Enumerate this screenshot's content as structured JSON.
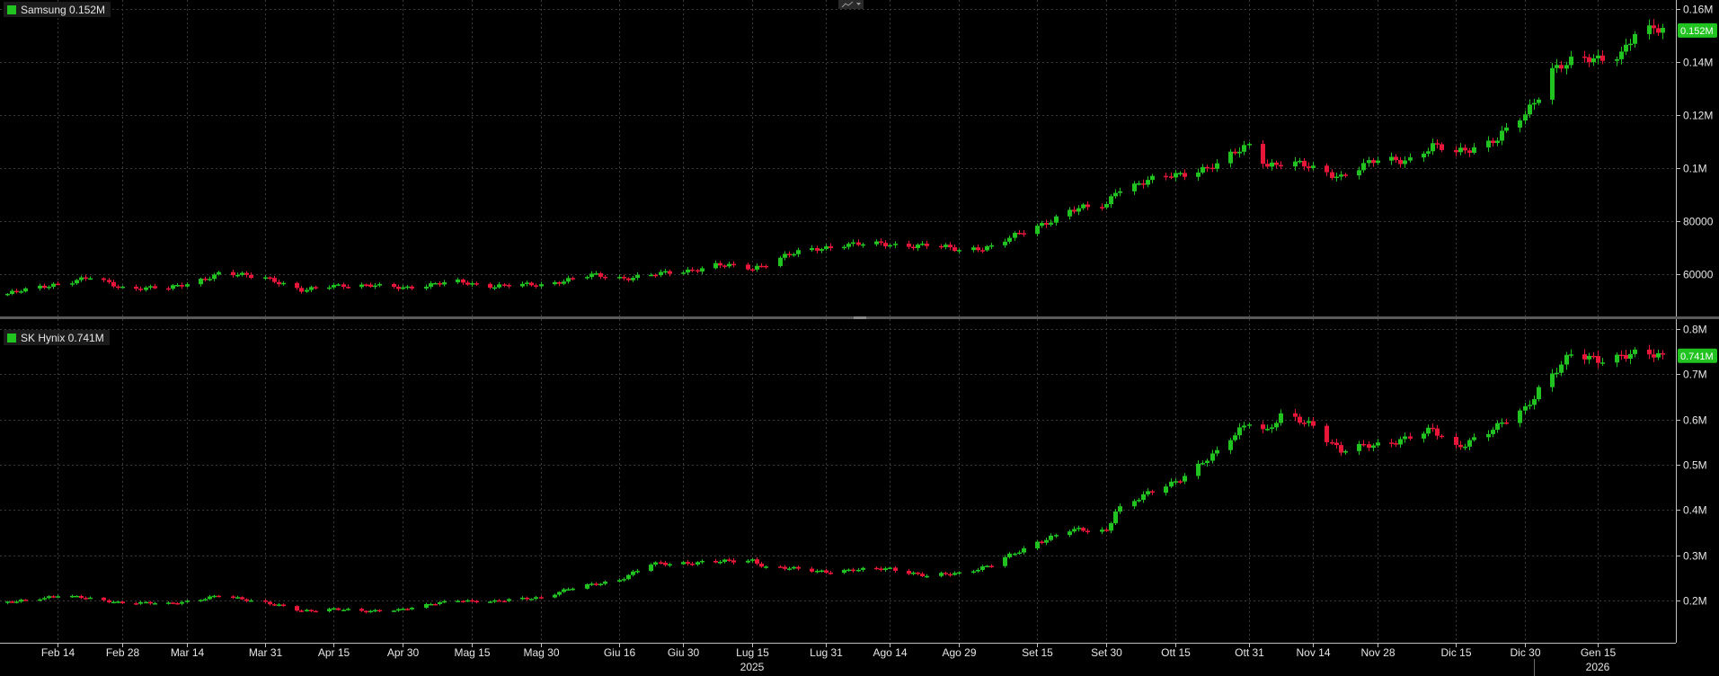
{
  "colors": {
    "up": "#21c321",
    "down": "#e8173a",
    "price_tag": "#21c321",
    "grid": "#3a3a3a",
    "axis_text": "#e6e6e6"
  },
  "toolbar": {
    "icon": "chart-type-icon"
  },
  "chart_data": [
    {
      "type": "candlestick",
      "name": "Samsung",
      "legend": "Samsung 0.152M",
      "last_label": "0.152M",
      "y_ticks": [
        {
          "value": 60000,
          "label": "60000"
        },
        {
          "value": 80000,
          "label": "80000"
        },
        {
          "value": 100000,
          "label": "0.1M"
        },
        {
          "value": 120000,
          "label": "0.12M"
        },
        {
          "value": 140000,
          "label": "0.14M"
        },
        {
          "value": 160000,
          "label": "0.16M"
        }
      ],
      "ylim": [
        44000,
        163500
      ],
      "anchors": [
        [
          "2025-02-03",
          52500
        ],
        [
          "2025-02-14",
          56500
        ],
        [
          "2025-02-21",
          58500
        ],
        [
          "2025-02-28",
          55000
        ],
        [
          "2025-03-10",
          54500
        ],
        [
          "2025-03-21",
          60000
        ],
        [
          "2025-03-31",
          59000
        ],
        [
          "2025-04-08",
          53500
        ],
        [
          "2025-04-15",
          56000
        ],
        [
          "2025-04-30",
          55000
        ],
        [
          "2025-05-12",
          57000
        ],
        [
          "2025-05-20",
          55500
        ],
        [
          "2025-05-30",
          56000
        ],
        [
          "2025-06-10",
          59500
        ],
        [
          "2025-06-17",
          58500
        ],
        [
          "2025-06-30",
          61000
        ],
        [
          "2025-07-07",
          63500
        ],
        [
          "2025-07-15",
          62000
        ],
        [
          "2025-07-22",
          67000
        ],
        [
          "2025-07-31",
          70000
        ],
        [
          "2025-08-04",
          71500
        ],
        [
          "2025-08-14",
          71000
        ],
        [
          "2025-08-22",
          71000
        ],
        [
          "2025-08-29",
          69000
        ],
        [
          "2025-09-05",
          70500
        ],
        [
          "2025-09-15",
          78000
        ],
        [
          "2025-09-22",
          84000
        ],
        [
          "2025-09-30",
          86000
        ],
        [
          "2025-10-02",
          92000
        ],
        [
          "2025-10-15",
          97500
        ],
        [
          "2025-10-24",
          101000
        ],
        [
          "2025-10-31",
          109000
        ],
        [
          "2025-11-04",
          101500
        ],
        [
          "2025-11-10",
          101500
        ],
        [
          "2025-11-14",
          100000
        ],
        [
          "2025-11-20",
          97000
        ],
        [
          "2025-11-28",
          103000
        ],
        [
          "2025-12-05",
          103500
        ],
        [
          "2025-12-10",
          108000
        ],
        [
          "2025-12-15",
          106000
        ],
        [
          "2025-12-24",
          111000
        ],
        [
          "2025-12-30",
          120000
        ],
        [
          "2026-01-02",
          128000
        ],
        [
          "2026-01-05",
          138000
        ],
        [
          "2026-01-09",
          140000
        ],
        [
          "2026-01-15",
          141000
        ],
        [
          "2026-01-20",
          144000
        ],
        [
          "2026-01-23",
          151000
        ],
        [
          "2026-01-29",
          152000
        ]
      ]
    },
    {
      "type": "candlestick",
      "name": "SK Hynix",
      "legend": "SK Hynix 0.741M",
      "last_label": "0.741M",
      "y_ticks": [
        {
          "value": 200000,
          "label": "0.2M"
        },
        {
          "value": 300000,
          "label": "0.3M"
        },
        {
          "value": 400000,
          "label": "0.4M"
        },
        {
          "value": 500000,
          "label": "0.5M"
        },
        {
          "value": 600000,
          "label": "0.6M"
        },
        {
          "value": 700000,
          "label": "0.7M"
        },
        {
          "value": 800000,
          "label": "0.8M"
        }
      ],
      "ylim": [
        107000,
        822000
      ],
      "anchors": [
        [
          "2025-02-03",
          195000
        ],
        [
          "2025-02-14",
          212000
        ],
        [
          "2025-02-28",
          196000
        ],
        [
          "2025-03-10",
          193000
        ],
        [
          "2025-03-21",
          210000
        ],
        [
          "2025-03-31",
          197000
        ],
        [
          "2025-04-08",
          176000
        ],
        [
          "2025-04-15",
          183000
        ],
        [
          "2025-04-22",
          175000
        ],
        [
          "2025-04-30",
          182000
        ],
        [
          "2025-05-12",
          201000
        ],
        [
          "2025-05-20",
          198000
        ],
        [
          "2025-05-30",
          208000
        ],
        [
          "2025-06-05",
          225000
        ],
        [
          "2025-06-16",
          247000
        ],
        [
          "2025-06-23",
          280000
        ],
        [
          "2025-06-30",
          284000
        ],
        [
          "2025-07-07",
          285000
        ],
        [
          "2025-07-15",
          290000
        ],
        [
          "2025-07-18",
          274000
        ],
        [
          "2025-07-31",
          265000
        ],
        [
          "2025-08-07",
          267000
        ],
        [
          "2025-08-14",
          272000
        ],
        [
          "2025-08-22",
          253000
        ],
        [
          "2025-08-29",
          262000
        ],
        [
          "2025-09-05",
          278000
        ],
        [
          "2025-09-15",
          330000
        ],
        [
          "2025-09-22",
          355000
        ],
        [
          "2025-09-30",
          355000
        ],
        [
          "2025-10-02",
          400000
        ],
        [
          "2025-10-10",
          440000
        ],
        [
          "2025-10-15",
          465000
        ],
        [
          "2025-10-24",
          525000
        ],
        [
          "2025-10-31",
          600000
        ],
        [
          "2025-11-04",
          575000
        ],
        [
          "2025-11-07",
          605000
        ],
        [
          "2025-11-14",
          590000
        ],
        [
          "2025-11-20",
          530000
        ],
        [
          "2025-11-28",
          545000
        ],
        [
          "2025-12-05",
          562000
        ],
        [
          "2025-12-10",
          575000
        ],
        [
          "2025-12-15",
          540000
        ],
        [
          "2025-12-24",
          582000
        ],
        [
          "2025-12-30",
          625000
        ],
        [
          "2026-01-02",
          670000
        ],
        [
          "2026-01-09",
          740000
        ],
        [
          "2026-01-15",
          735000
        ],
        [
          "2026-01-20",
          742000
        ],
        [
          "2026-01-29",
          741000
        ]
      ]
    }
  ],
  "x_axis": {
    "start_date": "2025-02-03",
    "end_date": "2026-01-29",
    "ticks": [
      {
        "date": "2025-02-14",
        "label": "Feb 14"
      },
      {
        "date": "2025-02-28",
        "label": "Feb 28"
      },
      {
        "date": "2025-03-14",
        "label": "Mar 14"
      },
      {
        "date": "2025-03-31",
        "label": "Mar 31"
      },
      {
        "date": "2025-04-15",
        "label": "Apr 15"
      },
      {
        "date": "2025-04-30",
        "label": "Apr 30"
      },
      {
        "date": "2025-05-15",
        "label": "Mag 15"
      },
      {
        "date": "2025-05-30",
        "label": "Mag 30"
      },
      {
        "date": "2025-06-16",
        "label": "Giu 16"
      },
      {
        "date": "2025-06-30",
        "label": "Giu 30"
      },
      {
        "date": "2025-07-15",
        "label": "Lug 15"
      },
      {
        "date": "2025-07-31",
        "label": "Lug 31"
      },
      {
        "date": "2025-08-14",
        "label": "Ago 14"
      },
      {
        "date": "2025-08-29",
        "label": "Ago 29"
      },
      {
        "date": "2025-09-15",
        "label": "Set 15"
      },
      {
        "date": "2025-09-30",
        "label": "Set 30"
      },
      {
        "date": "2025-10-15",
        "label": "Ott 15"
      },
      {
        "date": "2025-10-31",
        "label": "Ott 31"
      },
      {
        "date": "2025-11-14",
        "label": "Nov 14"
      },
      {
        "date": "2025-11-28",
        "label": "Nov 28"
      },
      {
        "date": "2025-12-15",
        "label": "Dic 15"
      },
      {
        "date": "2025-12-30",
        "label": "Dic 30"
      },
      {
        "date": "2026-01-15",
        "label": "Gen 15"
      }
    ],
    "years": [
      {
        "date": "2025-07-15",
        "label": "2025"
      },
      {
        "date": "2026-01-15",
        "label": "2026"
      }
    ]
  }
}
